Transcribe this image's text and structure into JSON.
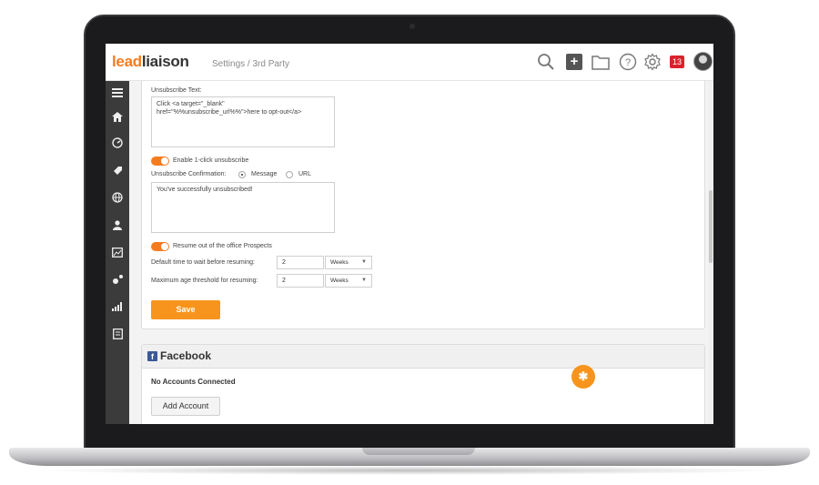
{
  "app": {
    "logo_lead": "lead",
    "logo_liaison": "liaison",
    "breadcrumb": "Settings / 3rd Party",
    "notification_count": "13"
  },
  "toolbar": {
    "icons": [
      "search-icon",
      "plus-icon",
      "folder-icon",
      "help-icon",
      "gear-icon",
      "notification-badge",
      "avatar"
    ]
  },
  "sidebar": {
    "items": [
      "menu-icon",
      "home-icon",
      "dashboard-icon",
      "tag-icon",
      "globe-icon",
      "user-icon",
      "image-icon",
      "settings-icon",
      "analytics-icon",
      "report-icon"
    ]
  },
  "unsubscribe": {
    "text_label": "Unsubscribe Text:",
    "text_value_line1": "Click <a target=\"_blank\"",
    "text_value_line2": "href=\"%%unsubscribe_url%%\">here to opt-out</a>",
    "one_click_label": "Enable 1-click unsubscribe",
    "one_click_enabled": true,
    "confirmation_label": "Unsubscribe Confirmation:",
    "option_message": "Message",
    "option_url": "URL",
    "selected_option": "Message",
    "confirmation_text": "You've successfully unsubscribed!"
  },
  "resume": {
    "toggle_label": "Resume out of the office Prospects",
    "enabled": true,
    "wait_label": "Default time to wait before resuming:",
    "wait_value": "2",
    "wait_unit": "Weeks",
    "age_label": "Maximum age threshold for resuming:",
    "age_value": "2",
    "age_unit": "Weeks"
  },
  "actions": {
    "save_label": "Save"
  },
  "facebook": {
    "logo_letter": "f",
    "title": "Facebook",
    "status": "No Accounts Connected",
    "add_label": "Add Account"
  },
  "colors": {
    "accent": "#f47c20",
    "button": "#f7941d",
    "facebook": "#3b5998",
    "badge": "#d9232b",
    "sidebar": "#3b3b3b"
  }
}
